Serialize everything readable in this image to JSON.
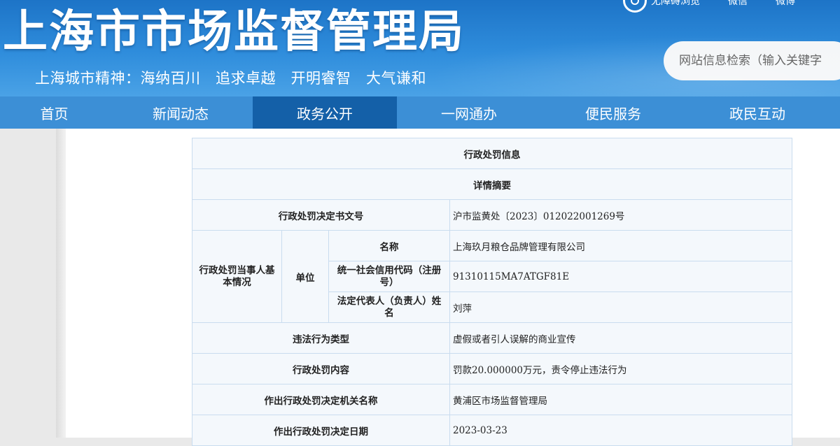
{
  "header": {
    "title": "上海市市场监督管理局",
    "slogan": "上海城市精神：海纳百川　追求卓越　开明睿智　大气谦和",
    "top_links": [
      "无障碍浏览",
      "微信",
      "微博"
    ],
    "search_placeholder": "网站信息检索（输入关键字"
  },
  "nav": {
    "items": [
      {
        "label": "首页",
        "active": false
      },
      {
        "label": "新闻动态",
        "active": false
      },
      {
        "label": "政务公开",
        "active": true
      },
      {
        "label": "一网通办",
        "active": false
      },
      {
        "label": "便民服务",
        "active": false
      },
      {
        "label": "政民互动",
        "active": false
      }
    ]
  },
  "table": {
    "title": "行政处罚信息",
    "subtitle": "详情摘要",
    "decision_no_label": "行政处罚决定书文号",
    "decision_no": "沪市监黄处〔2023〕012022001269号",
    "party_label": "行政处罚当事人基本情况",
    "unit_label": "单位",
    "name_label": "名称",
    "name": "上海玖月粮仓品牌管理有限公司",
    "credit_code_label": "统一社会信用代码（注册号）",
    "credit_code": "91310115MA7ATGF81E",
    "legal_rep_label": "法定代表人（负责人）姓名",
    "legal_rep": "刘萍",
    "violation_type_label": "违法行为类型",
    "violation_type": "虚假或者引人误解的商业宣传",
    "penalty_content_label": "行政处罚内容",
    "penalty_content": "罚款20.000000万元，责令停止违法行为",
    "authority_label": "作出行政处罚决定机关名称",
    "authority": "黄浦区市场监督管理局",
    "date_label": "作出行政处罚决定日期",
    "date": "2023-03-23"
  },
  "colors": {
    "header_blue": "#2f8ddc",
    "nav_blue": "#3c8fd6",
    "nav_active": "#1460a8",
    "table_border": "#c9dcef",
    "table_bg": "#f4f8fc"
  }
}
